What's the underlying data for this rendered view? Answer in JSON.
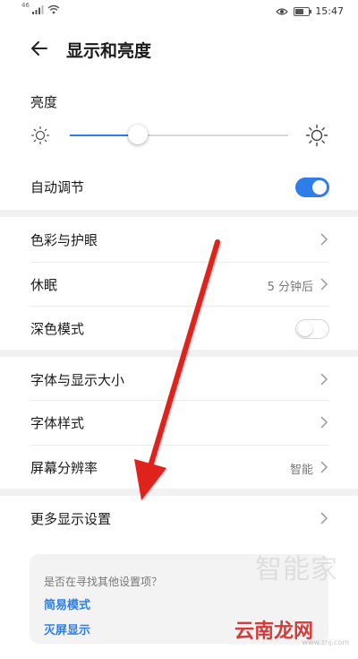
{
  "status_bar": {
    "network": "46",
    "time": "15:47"
  },
  "header": {
    "title": "显示和亮度"
  },
  "brightness": {
    "label": "亮度",
    "level": 0.31
  },
  "auto_adjust": {
    "label": "自动调节",
    "enabled": true
  },
  "groups": {
    "color": {
      "label": "色彩与护眼"
    },
    "sleep": {
      "label": "休眠",
      "value": "5 分钟后"
    },
    "dark_mode": {
      "label": "深色模式",
      "enabled": false
    },
    "font_size": {
      "label": "字体与显示大小"
    },
    "font_style": {
      "label": "字体样式"
    },
    "resolution": {
      "label": "屏幕分辨率",
      "value": "智能"
    },
    "more": {
      "label": "更多显示设置"
    }
  },
  "suggestion_card": {
    "question": "是否在寻找其他设置项？",
    "links": [
      "简易模式",
      "灭屏显示"
    ]
  },
  "watermark": {
    "top": "智能家",
    "main": "云南龙网",
    "url": "www.znj.com"
  },
  "colors": {
    "accent": "#2d7ee8",
    "annotation_arrow": "#e0221c"
  },
  "icons": {
    "back": "arrow-left-icon",
    "brightness_low": "sun-small-icon",
    "brightness_high": "sun-large-icon",
    "chevron": "chevron-right-icon"
  }
}
